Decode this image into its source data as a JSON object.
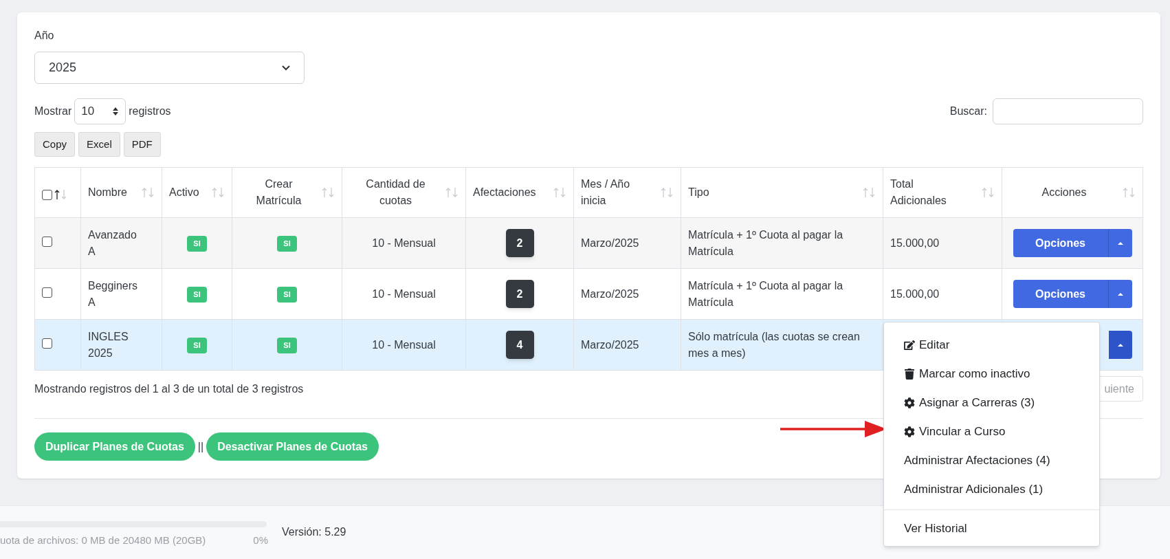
{
  "year": {
    "label": "Año",
    "value": "2025"
  },
  "length": {
    "before": "Mostrar",
    "value": "10",
    "after": "registros"
  },
  "search": {
    "label": "Buscar:"
  },
  "export_buttons": [
    "Copy",
    "Excel",
    "PDF"
  ],
  "table": {
    "select_all": {
      "checked": false,
      "sorted": true
    },
    "columns": [
      {
        "label": "Nombre",
        "sorted": false
      },
      {
        "label": "Activo",
        "sorted": false
      },
      {
        "label": "Crear Matrícula",
        "sorted": false
      },
      {
        "label": "Cantidad de cuotas",
        "sorted": false
      },
      {
        "label": "Afectaciones",
        "sorted": false
      },
      {
        "label": "Mes / Año inicia",
        "sorted": false
      },
      {
        "label": "Tipo",
        "sorted": false
      },
      {
        "label": "Total Adicionales",
        "sorted": false
      },
      {
        "label": "Acciones",
        "sorted": false
      }
    ],
    "rows": [
      {
        "checked": false,
        "selected": false,
        "name": "Avanzado A",
        "active": "SI",
        "create_enrollment": "SI",
        "installments": "10 - Mensual",
        "affectations": "2",
        "start": "Marzo/2025",
        "type": "Matrícula + 1º Cuota al pagar la Matrícula",
        "total_additional": "15.000,00",
        "action": "Opciones",
        "menu_open": false
      },
      {
        "checked": false,
        "selected": false,
        "name": "Begginers A",
        "active": "SI",
        "create_enrollment": "SI",
        "installments": "10 - Mensual",
        "affectations": "2",
        "start": "Marzo/2025",
        "type": "Matrícula + 1º Cuota al pagar la Matrícula",
        "total_additional": "15.000,00",
        "action": "Opciones",
        "menu_open": false
      },
      {
        "checked": false,
        "selected": true,
        "name": "INGLES 2025",
        "active": "SI",
        "create_enrollment": "SI",
        "installments": "10 - Mensual",
        "affectations": "4",
        "start": "Marzo/2025",
        "type": "Sólo matrícula (las cuotas se crean mes a mes)",
        "menu_open": true
      }
    ]
  },
  "info": "Mostrando registros del 1 al 3 de un total de 3 registros",
  "pagination": {
    "next": "uiente"
  },
  "bulk_buttons": [
    "Duplicar Planes de Cuotas",
    "Desactivar Planes de Cuotas"
  ],
  "bulk_separator": "||",
  "footer": {
    "storage": {
      "text": "uota de archivos: 0 MB de 20480 MB (20GB)",
      "percent": "0%"
    },
    "version": "Versión: 5.29"
  },
  "menu": {
    "groups": [
      [
        {
          "label": "Editar"
        },
        {
          "label": "Marcar como inactivo"
        },
        {
          "label": "Asignar a Carreras (3)"
        },
        {
          "label": "Vincular a Curso"
        },
        {
          "label": "Administrar Afectaciones (4)"
        },
        {
          "label": "Administrar Adicionales (1)"
        }
      ],
      [
        {
          "label": "Ver Historial"
        }
      ]
    ]
  }
}
